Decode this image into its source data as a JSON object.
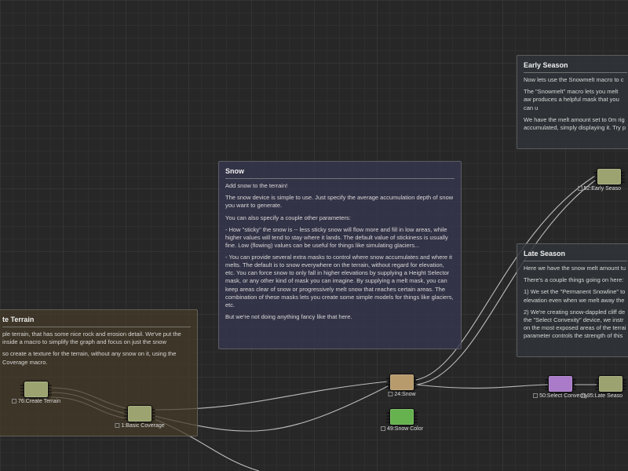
{
  "panels": {
    "terrain": {
      "title": "te Terrain",
      "p1": "ple terrain, that has some nice rock and erosion detail.  We've put the inside a macro to simplify the graph and focus on just the snow",
      "p2": "",
      "p3": "so create a texture for the terrain, without any snow on it, using the Coverage macro."
    },
    "snow": {
      "title": "Snow",
      "p1": "Add snow to the terrain!",
      "p2": "The snow device is simple to use. Just specify the average accumulation depth of snow you want to generate.",
      "p3": "You can also specify a couple other parameters:",
      "p4": "- How \"sticky\" the snow is -- less sticky snow will flow more and fill in low areas, while higher values will tend to stay where it lands. The default value of stickiness is usually fine. Low (flowing) values can be useful for things like simulating glaciers...",
      "p5": "- You can provide several extra masks to control where snow accumulates and where it melts. The default is to snow everywhere on the terrain, without regard for elevation, etc. You can force snow to only fall in higher elevations by supplying a Height Selector mask, or any other kind of mask you can imagine. By supplying a melt mask, you can keep areas clear of snow or progressively melt snow that reaches certain areas. The combination of these masks lets you create some simple models for things like glaciers, etc.",
      "p6": "But we're not doing anything fancy like that here."
    },
    "early": {
      "title": "Early Season",
      "p1": "Now lets use the Snowmelt macro to c",
      "p2": "The \"Snowmelt\" macro lets you melt aw  produces a helpful mask that you can u",
      "p3": "We have the melt amount set to 0m rig  accumulated, simply displaying it. Try p"
    },
    "late": {
      "title": "Late Season",
      "p1": "Here we have the snow melt amount tu",
      "p2": "There's a couple things going on here:",
      "p3": "1) We set the \"Permanent Snowline\" to elevation even when we melt away the",
      "p4": "2) We're creating snow-dappled cliff de  the \"Select Convexity\" device, we instr  on the most exposed areas of the terrai  parameter controls the strength of this"
    }
  },
  "nodes": {
    "createTerrain": {
      "label": "76:Create Terrain"
    },
    "basicCoverage": {
      "label": "1:Basic Coverage"
    },
    "snow": {
      "label": "24:Snow"
    },
    "snowColor": {
      "label": "49:Snow Color"
    },
    "earlySeason": {
      "label": "52:Early Seaso"
    },
    "selectConvex": {
      "label": "50:Select Convexity"
    },
    "lateSeason": {
      "label": "35:Late Seaso"
    }
  },
  "colors": {
    "olive": "#9da370",
    "tan": "#b79b6c",
    "green": "#66b24f",
    "purple": "#a97bc8"
  }
}
